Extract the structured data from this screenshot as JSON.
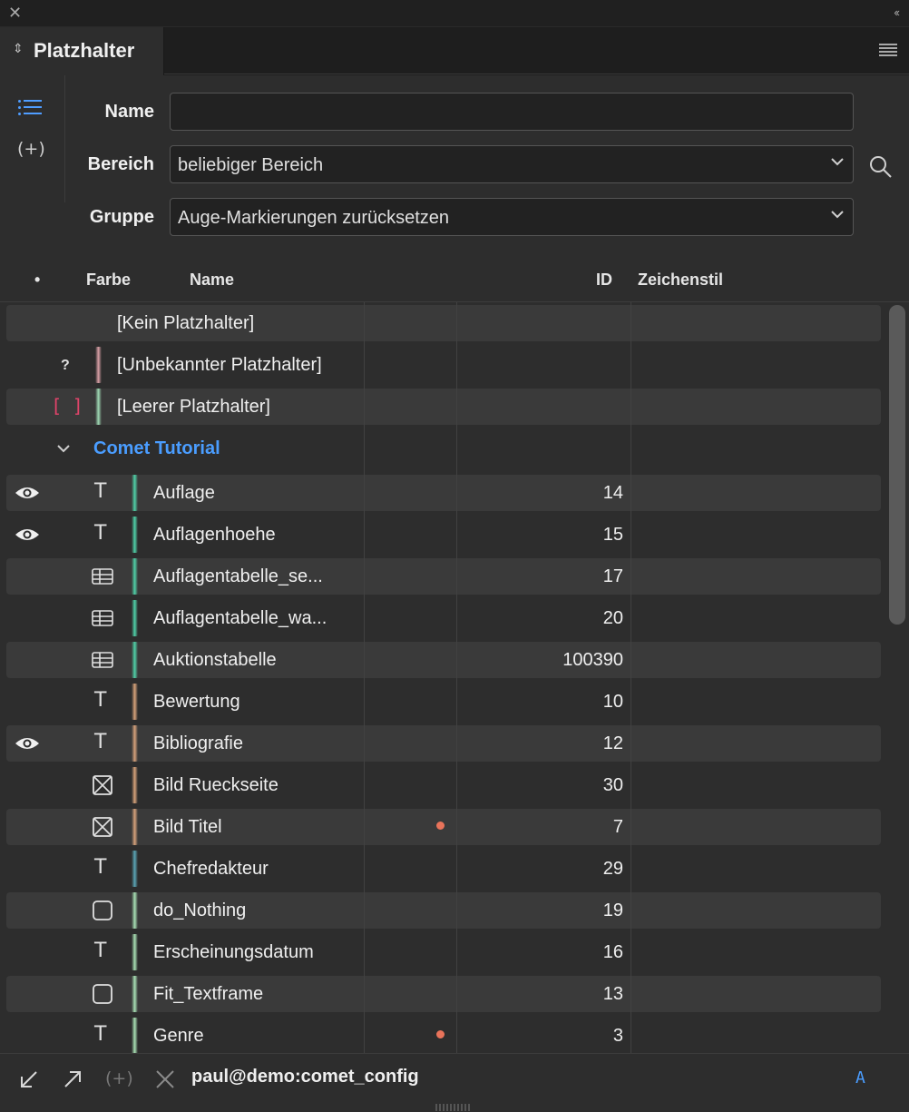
{
  "window": {
    "close_glyph": "✕",
    "collapse_glyph": "‹‹"
  },
  "tab": {
    "title": "Platzhalter",
    "sort_glyph": "⇕"
  },
  "filters": {
    "name_label": "Name",
    "name_value": "",
    "bereich_label": "Bereich",
    "bereich_value": "beliebiger Bereich",
    "gruppe_label": "Gruppe",
    "gruppe_value": "Auge-Markierungen zurücksetzen"
  },
  "sidebar": {
    "plus_glyph": "(+)"
  },
  "columns": {
    "dot": "•",
    "color": "Farbe",
    "name": "Name",
    "id": "ID",
    "charstyle": "Zeichenstil"
  },
  "special_rows": [
    {
      "name": "[Kein Platzhalter]"
    },
    {
      "name": "[Unbekannter Platzhalter]",
      "icon_text": "?",
      "chip": "#d9a0a6"
    },
    {
      "name": "[Leerer Platzhalter]",
      "icon_text": "[ ]",
      "chip": "#9fd9b4"
    }
  ],
  "group": {
    "title": "Comet Tutorial"
  },
  "rows": [
    {
      "name": "Auflage",
      "id": "14",
      "eye": true,
      "type": "text",
      "chip": "#4fd1a8"
    },
    {
      "name": "Auflagenhoehe",
      "id": "15",
      "eye": true,
      "type": "text",
      "chip": "#4fd1a8"
    },
    {
      "name": "Auflagentabelle_se...",
      "id": "17",
      "eye": false,
      "type": "table",
      "chip": "#4fd1a8"
    },
    {
      "name": "Auflagentabelle_wa...",
      "id": "20",
      "eye": false,
      "type": "table",
      "chip": "#4fd1a8"
    },
    {
      "name": "Auktionstabelle",
      "id": "100390",
      "eye": false,
      "type": "table",
      "chip": "#4fd1a8"
    },
    {
      "name": "Bewertung",
      "id": "10",
      "eye": false,
      "type": "text",
      "chip": "#d6a27a"
    },
    {
      "name": "Bibliografie",
      "id": "12",
      "eye": true,
      "type": "text",
      "chip": "#d6a27a"
    },
    {
      "name": "Bild Rueckseite",
      "id": "30",
      "eye": false,
      "type": "image",
      "chip": "#d6a27a"
    },
    {
      "name": "Bild Titel",
      "id": "7",
      "eye": false,
      "type": "image",
      "chip": "#d6a27a",
      "dot": true
    },
    {
      "name": "Chefredakteur",
      "id": "29",
      "eye": false,
      "type": "text",
      "chip": "#5aa5b5"
    },
    {
      "name": "do_Nothing",
      "id": "19",
      "eye": false,
      "type": "frame",
      "chip": "#a8e0b4"
    },
    {
      "name": "Erscheinungsdatum",
      "id": "16",
      "eye": false,
      "type": "text",
      "chip": "#a8e0b4"
    },
    {
      "name": "Fit_Textframe",
      "id": "13",
      "eye": false,
      "type": "frame",
      "chip": "#a8e0b4"
    },
    {
      "name": "Genre",
      "id": "3",
      "eye": false,
      "type": "text",
      "chip": "#a8e0b4",
      "dot": true
    }
  ],
  "footer": {
    "plus_glyph": "(+)",
    "connection": "paul@demo:comet_config",
    "mode": "A"
  },
  "colors": {
    "accent": "#4a9dff",
    "panel": "#2d2d2d",
    "row_alt": "#3a3a3a",
    "dot": "#e8735a",
    "brackets": "#e0446a"
  }
}
